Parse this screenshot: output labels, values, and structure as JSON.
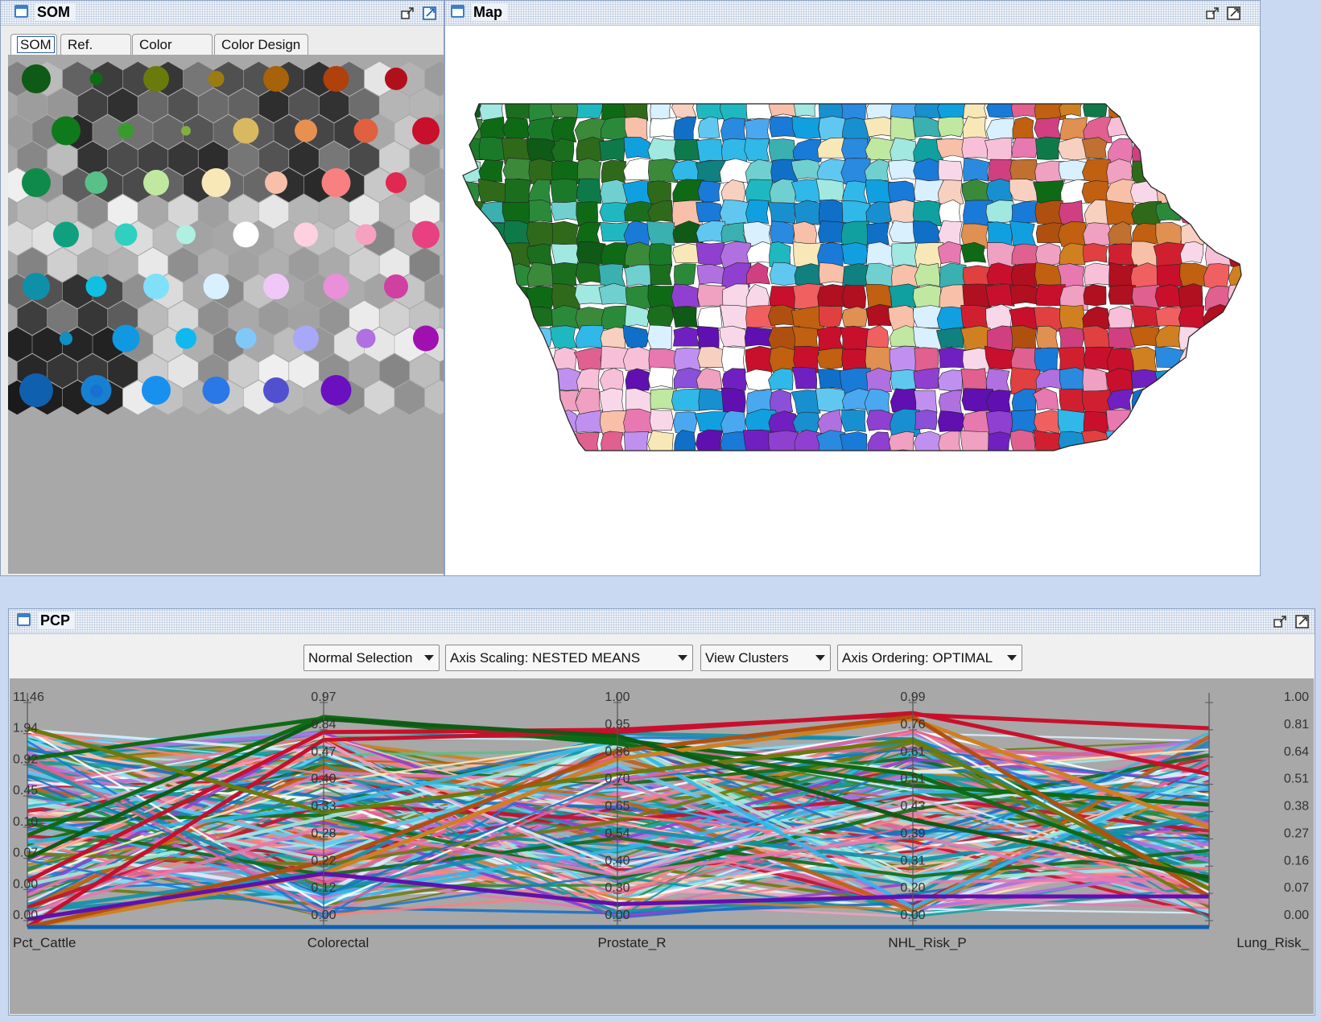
{
  "som_panel": {
    "title": "SOM",
    "tabs": [
      "SOM",
      "Ref. SOM",
      "Color Array",
      "Color Design"
    ],
    "active_tab": "SOM"
  },
  "map_panel": {
    "title": "Map"
  },
  "pcp_panel": {
    "title": "PCP",
    "dropdowns": {
      "selection": "Normal Selection",
      "scaling": "Axis Scaling: NESTED MEANS",
      "clusters": "View Clusters",
      "ordering": "Axis Ordering: OPTIMAL"
    },
    "axes": [
      {
        "name": "Pct_Cattle",
        "ticks": [
          "11.46",
          "1.94",
          "0.92",
          "0.45",
          "0.10",
          "0.07",
          "0.00",
          "0.00"
        ]
      },
      {
        "name": "Colorectal",
        "ticks": [
          "0.97",
          "0.84",
          "0.47",
          "0.40",
          "0.33",
          "0.28",
          "0.22",
          "0.12",
          "0.00"
        ]
      },
      {
        "name": "Prostate_R",
        "ticks": [
          "1.00",
          "0.95",
          "0.86",
          "0.70",
          "0.65",
          "0.54",
          "0.40",
          "0.30",
          "0.00"
        ]
      },
      {
        "name": "NHL_Risk_P",
        "ticks": [
          "0.99",
          "0.76",
          "0.61",
          "0.51",
          "0.43",
          "0.39",
          "0.31",
          "0.20",
          "0.00"
        ]
      },
      {
        "name": "Lung_Risk_",
        "ticks": [
          "1.00",
          "0.81",
          "0.64",
          "0.51",
          "0.38",
          "0.27",
          "0.16",
          "0.07",
          "0.00"
        ]
      }
    ]
  },
  "colors": {
    "som_rows": [
      [
        "#0f5a16",
        "#0f6a16",
        "#6b7a0c",
        "#9a7c10",
        "#a8620a",
        "#b0400c",
        "#b0101c"
      ],
      [
        "#0f7a1c",
        "#3a9a30",
        "#80b040",
        "#d8b860",
        "#e89050",
        "#e06040",
        "#c8102c"
      ],
      [
        "#0f8a4a",
        "#5ac08a",
        "#c0e8a0",
        "#f8e8b8",
        "#f8c0a8",
        "#f88080",
        "#e02850"
      ],
      [
        "#10a080",
        "#30d0c0",
        "#b0f0e0",
        "#ffffff",
        "#ffd0e0",
        "#f8a0c0",
        "#e84080"
      ],
      [
        "#1090a8",
        "#10c0e0",
        "#80e0f8",
        "#d8f0ff",
        "#f0c8f8",
        "#e890d8",
        "#d040a0"
      ],
      [
        "#1870c8",
        "#1098e0",
        "#10b8f0",
        "#80c8f8",
        "#a8a8f8",
        "#b070e0",
        "#a010b0"
      ],
      [
        "#1060b0",
        "#1880d0",
        "#1890f0",
        "#2a78e8",
        "#5050d0",
        "#6a10c0"
      ]
    ]
  }
}
